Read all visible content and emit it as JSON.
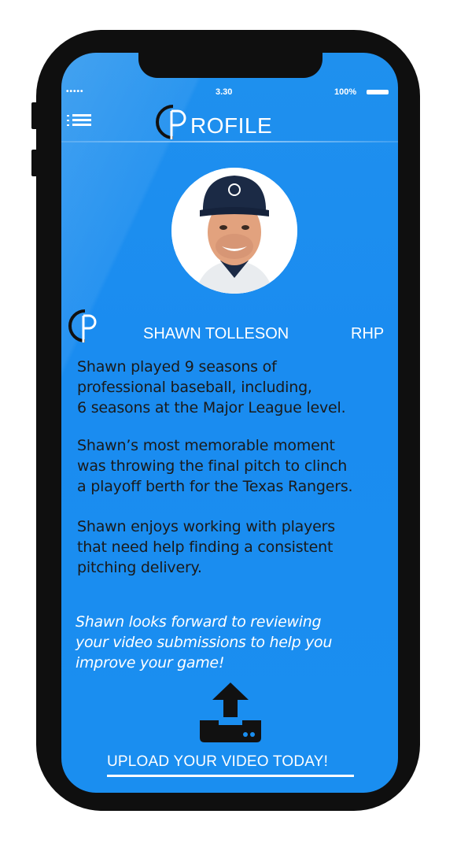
{
  "status_bar": {
    "signal": "•••••",
    "time": "3.30",
    "battery": "100%"
  },
  "header": {
    "title": "ROFILE",
    "logo_letter": "P"
  },
  "profile": {
    "name": "SHAWN TOLLESON",
    "position": "RHP"
  },
  "bio": {
    "paragraph_1": "   Shawn played 9 seasons of\nprofessional baseball, including,\n6 seasons at the Major League level.",
    "paragraph_2": "   Shawn’s most memorable moment\nwas throwing the final pitch to clinch\na playoff berth for the Texas Rangers.",
    "paragraph_3": "   Shawn enjoys working with players\nthat need help finding a consistent\npitching delivery."
  },
  "cta": {
    "text": "   Shawn looks forward to reviewing\nyour video submissions to help you\nimprove your game!"
  },
  "upload": {
    "label": "UPLOAD YOUR VIDEO TODAY!"
  },
  "colors": {
    "screen_blue": "#1a8ef0",
    "phone_frame": "#0f0f0f",
    "text_dark": "#1a1a1a",
    "text_light": "#ffffff"
  },
  "icons": [
    "menu-icon",
    "brand-logo-icon",
    "upload-icon"
  ]
}
